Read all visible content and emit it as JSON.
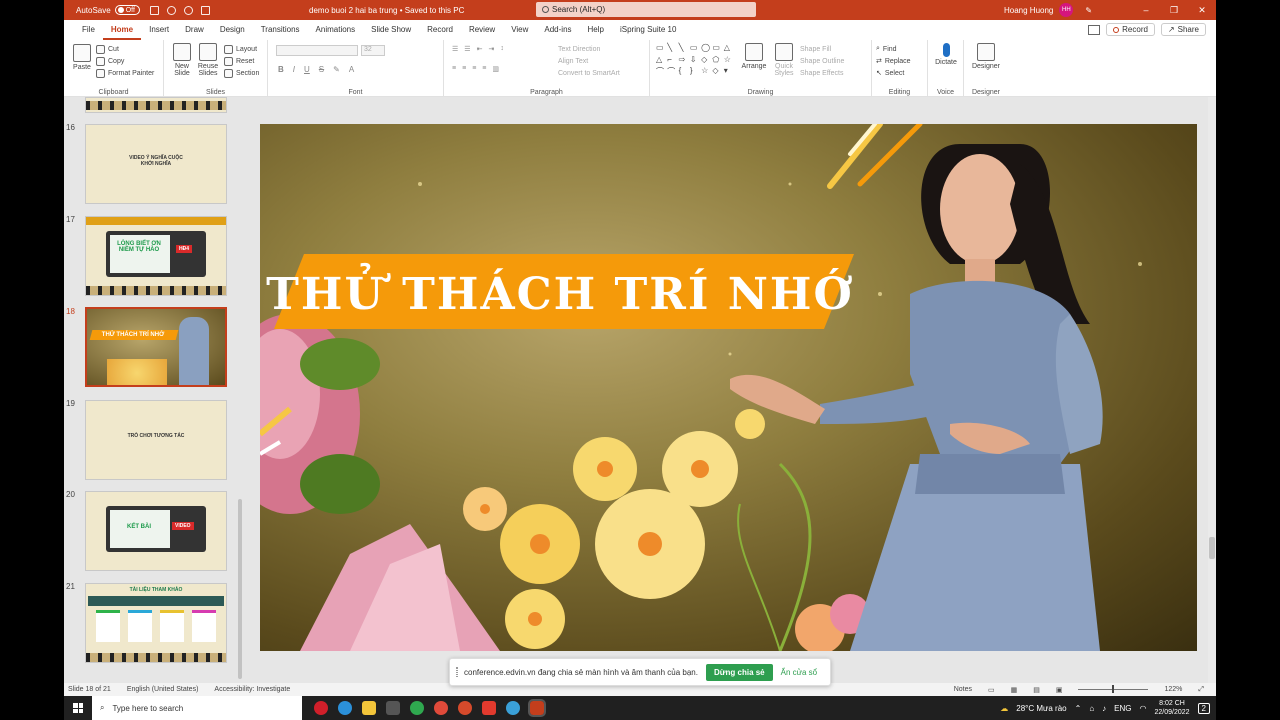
{
  "titlebar": {
    "autosave_label": "AutoSave",
    "autosave_state": "Off",
    "document_title": "demo buoi 2 hai ba trung • Saved to this PC",
    "search_placeholder": "Search (Alt+Q)",
    "user_name": "Hoang Huong",
    "user_initials": "HH"
  },
  "tabs": [
    "File",
    "Home",
    "Insert",
    "Draw",
    "Design",
    "Transitions",
    "Animations",
    "Slide Show",
    "Record",
    "Review",
    "View",
    "Add-ins",
    "Help",
    "iSpring Suite 10"
  ],
  "active_tab": "Home",
  "tab_actions": {
    "record": "Record",
    "share": "Share"
  },
  "ribbon": {
    "clipboard": {
      "paste": "Paste",
      "cut": "Cut",
      "copy": "Copy",
      "format_painter": "Format Painter",
      "label": "Clipboard"
    },
    "slides": {
      "new_slide": "New Slide",
      "reuse_slides": "Reuse Slides",
      "layout": "Layout",
      "reset": "Reset",
      "section": "Section",
      "label": "Slides"
    },
    "font": {
      "label": "Font",
      "size": "32",
      "bold": "B",
      "italic": "I",
      "underline": "U",
      "strike": "S"
    },
    "paragraph": {
      "label": "Paragraph",
      "text_direction": "Text Direction",
      "align_text": "Align Text",
      "convert": "Convert to SmartArt"
    },
    "drawing": {
      "label": "Drawing",
      "arrange": "Arrange",
      "quick_styles": "Quick Styles",
      "shape_fill": "Shape Fill",
      "shape_outline": "Shape Outline",
      "shape_effects": "Shape Effects"
    },
    "editing": {
      "label": "Editing",
      "find": "Find",
      "replace": "Replace",
      "select": "Select"
    },
    "voice": {
      "label": "Voice",
      "dictate": "Dictate"
    },
    "designer": {
      "label": "Designer",
      "designer": "Designer"
    }
  },
  "slides_pane": [
    {
      "num": "16",
      "text": "VIDEO Ý NGHĨA CUỘC KHỞI NGHĨA"
    },
    {
      "num": "17",
      "text": "LÒNG BIẾT ƠN NIỀM TỰ HÀO",
      "badge": "HĐ4"
    },
    {
      "num": "18",
      "text": "THỬ THÁCH TRÍ NHỚ",
      "current": true
    },
    {
      "num": "19",
      "text": "TRÒ CHƠI TƯƠNG TÁC"
    },
    {
      "num": "20",
      "text": "KẾT BÀI",
      "badge": "VIDEO"
    },
    {
      "num": "21",
      "text": "TÀI LIỆU THAM KHẢO"
    }
  ],
  "slide": {
    "title": "THỬ THÁCH TRÍ NHỚ",
    "colors": {
      "banner": "#f59a0a",
      "title_text": "#ffffff",
      "dress": "#7d92b3"
    }
  },
  "status": {
    "slide_of": "Slide 18 of 21",
    "language": "English (United States)",
    "accessibility": "Accessibility: Investigate",
    "notes": "Notes",
    "zoom": "122%"
  },
  "share_bar": {
    "message": "conference.edvin.vn đang chia sẻ màn hình và âm thanh của bạn.",
    "stop": "Dừng chia sẻ",
    "hide": "Ẩn cửa sổ"
  },
  "taskbar": {
    "search_placeholder": "Type here to search",
    "weather": "28°C  Mưa rào",
    "lang": "ENG",
    "time": "8:02 CH",
    "date": "22/09/2022",
    "notifications": "2"
  }
}
